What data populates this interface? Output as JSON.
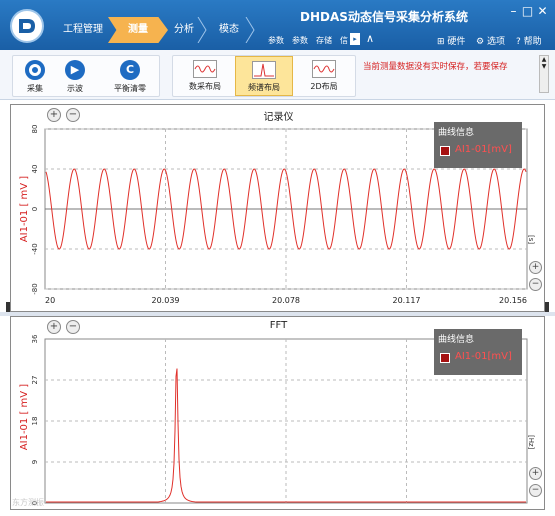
{
  "app": {
    "title": "DHDAS动态信号采集分析系统"
  },
  "nav": {
    "tabs": [
      {
        "label": "工程管理"
      },
      {
        "label": "测量"
      },
      {
        "label": "分析"
      },
      {
        "label": "模态"
      }
    ],
    "sub_links": [
      "参数",
      "参数",
      "存储",
      "信"
    ],
    "right": {
      "hardware": "硬件",
      "options": "选项",
      "help": "帮助"
    }
  },
  "window": {
    "minimize": "–",
    "maximize": "□",
    "close": "✕"
  },
  "ribbon": {
    "buttons": [
      {
        "label": "采集",
        "glyph": "○"
      },
      {
        "label": "示波",
        "glyph": "▶"
      },
      {
        "label": "平衡清零",
        "glyph": "C"
      }
    ],
    "layouts": [
      {
        "label": "数采布局"
      },
      {
        "label": "频谱布局"
      },
      {
        "label": "2D布局"
      }
    ],
    "message": "当前测量数据没有实时保存，若要保存"
  },
  "recorder": {
    "title": "记录仪",
    "legend_title": "曲线信息",
    "legend_item": "AI1-01[mV]",
    "ylabel": "AI1-01 [ mV ]",
    "xunit": "[s]",
    "colors": {
      "curve": "#e0302a",
      "legend_bg": "#6a6a6a"
    }
  },
  "fft": {
    "title": "FFT",
    "legend_title": "曲线信息",
    "legend_item": "AI1-01[mV]",
    "ylabel": "AI1-01 [ mV ]",
    "xunit": "[Hz]"
  },
  "watermark": "东方测振",
  "chart_data": [
    {
      "type": "line",
      "title": "记录仪",
      "ylabel": "AI1-01 [ mV ]",
      "xlabel": "[s]",
      "x_ticks": [
        "20",
        "20.039",
        "20.078",
        "20.117",
        "20.156"
      ],
      "y_ticks": [
        "80",
        "40",
        "0",
        "-40",
        "-80"
      ],
      "xlim": [
        20,
        20.156
      ],
      "ylim": [
        -80,
        80
      ],
      "series": [
        {
          "name": "AI1-01[mV]",
          "amplitude": 40,
          "cycles": 16
        }
      ],
      "legend": "top-right",
      "grid": true
    },
    {
      "type": "line",
      "title": "FFT",
      "ylabel": "AI1-01 [ mV ]",
      "xlabel": "[Hz]",
      "y_ticks": [
        "36",
        "27",
        "18",
        "9",
        "0"
      ],
      "ylim": [
        0,
        36
      ],
      "series": [
        {
          "name": "AI1-01[mV]",
          "peak_value": 31.5
        }
      ],
      "legend": "top-right",
      "grid": true
    }
  ]
}
